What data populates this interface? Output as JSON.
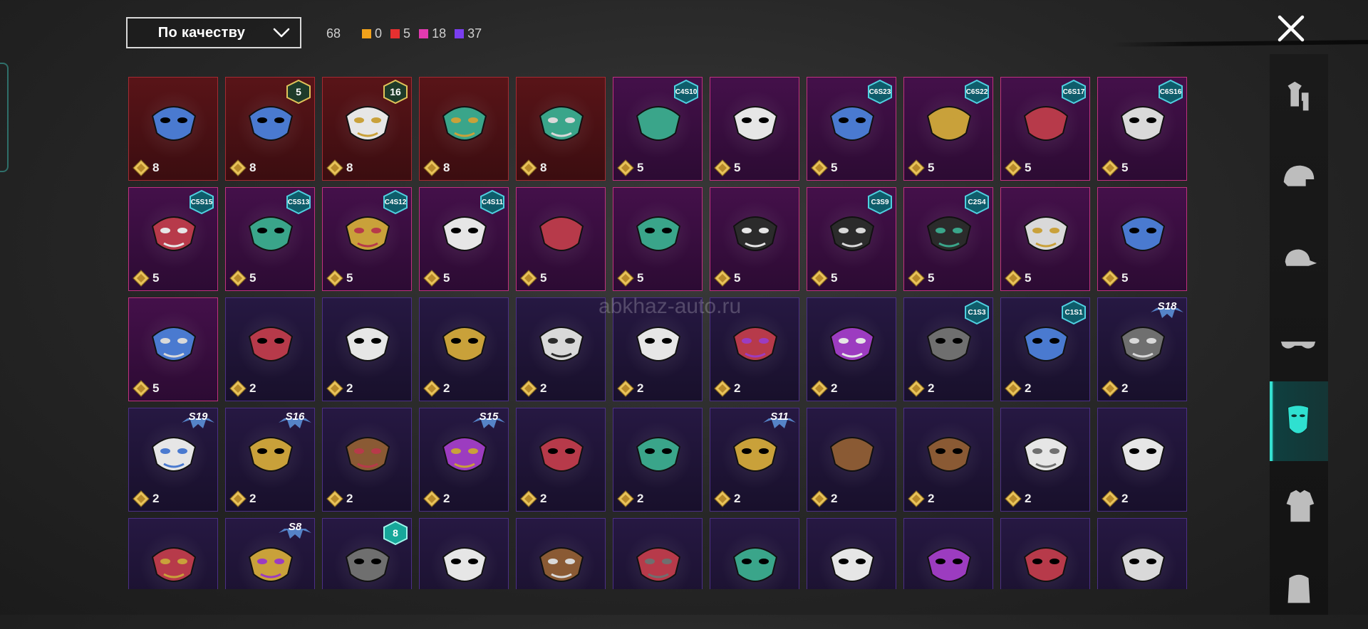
{
  "sort": {
    "label": "По качеству"
  },
  "counts": {
    "total": "68",
    "groups": [
      {
        "color": "#f2a21b",
        "value": "0"
      },
      {
        "color": "#e63030",
        "value": "5"
      },
      {
        "color": "#e23ab0",
        "value": "18"
      },
      {
        "color": "#7a3ef0",
        "value": "37"
      }
    ]
  },
  "watermark": "abkhaz-auto.ru",
  "items": [
    {
      "r": "red",
      "p": "8",
      "icon": "bug-gas-mask"
    },
    {
      "r": "red",
      "p": "8",
      "icon": "cyber-respirator",
      "b": {
        "t": "n",
        "v": "5"
      }
    },
    {
      "r": "red",
      "p": "8",
      "icon": "pharaoh-mask",
      "b": {
        "t": "n",
        "v": "16"
      }
    },
    {
      "r": "red",
      "p": "8",
      "icon": "cloth-face-mask"
    },
    {
      "r": "red",
      "p": "8",
      "icon": "dark-gas-mask"
    },
    {
      "r": "pink",
      "p": "5",
      "icon": "green-mouth-guard",
      "b": {
        "t": "h",
        "v": "C4S10"
      }
    },
    {
      "r": "pink",
      "p": "5",
      "icon": "brown-bandana"
    },
    {
      "r": "pink",
      "p": "5",
      "icon": "neon-face-mask",
      "b": {
        "t": "h",
        "v": "C6S23"
      }
    },
    {
      "r": "pink",
      "p": "5",
      "icon": "black-face-mask",
      "b": {
        "t": "h",
        "v": "C6S22"
      }
    },
    {
      "r": "pink",
      "p": "5",
      "icon": "cyan-visor-mask",
      "b": {
        "t": "h",
        "v": "C6S17"
      }
    },
    {
      "r": "pink",
      "p": "5",
      "icon": "bronze-gas-mask",
      "b": {
        "t": "h",
        "v": "C6S16"
      }
    },
    {
      "r": "pink",
      "p": "5",
      "icon": "yellow-respirator",
      "b": {
        "t": "h",
        "v": "C5S15"
      }
    },
    {
      "r": "pink",
      "p": "5",
      "icon": "graffiti-mask",
      "b": {
        "t": "h",
        "v": "C5S13"
      }
    },
    {
      "r": "pink",
      "p": "5",
      "icon": "fangs-face-mask",
      "b": {
        "t": "h",
        "v": "C4S12"
      }
    },
    {
      "r": "pink",
      "p": "5",
      "icon": "purple-respirator",
      "b": {
        "t": "h",
        "v": "C4S11"
      }
    },
    {
      "r": "pink",
      "p": "5",
      "icon": "kitsune-mask"
    },
    {
      "r": "pink",
      "p": "5",
      "icon": "pink-visor-mask"
    },
    {
      "r": "pink",
      "p": "5",
      "icon": "gold-warrior-mask"
    },
    {
      "r": "pink",
      "p": "5",
      "icon": "cyber-gas-mask",
      "b": {
        "t": "h",
        "v": "C3S9"
      }
    },
    {
      "r": "pink",
      "p": "5",
      "icon": "gold-robot-mask",
      "b": {
        "t": "h",
        "v": "C2S4"
      }
    },
    {
      "r": "pink",
      "p": "5",
      "icon": "white-cloth-mask"
    },
    {
      "r": "pink",
      "p": "5",
      "icon": "plague-doctor-mask"
    },
    {
      "r": "pink",
      "p": "5",
      "icon": "shredded-bandana"
    },
    {
      "r": "purple",
      "p": "2",
      "icon": "gold-venetian-mask"
    },
    {
      "r": "purple",
      "p": "2",
      "icon": "hockey-mask"
    },
    {
      "r": "purple",
      "p": "2",
      "icon": "armored-muzzle"
    },
    {
      "r": "purple",
      "p": "2",
      "icon": "red-eye-visor"
    },
    {
      "r": "purple",
      "p": "2",
      "icon": "mammoth-mask"
    },
    {
      "r": "purple",
      "p": "2",
      "icon": "pink-dino-mask"
    },
    {
      "r": "purple",
      "p": "2",
      "icon": "skull-teeth-mask"
    },
    {
      "r": "purple",
      "p": "2",
      "icon": "cactus-bandana",
      "b": {
        "t": "h",
        "v": "C1S3"
      }
    },
    {
      "r": "purple",
      "p": "2",
      "icon": "blue-shark-mask",
      "b": {
        "t": "h",
        "v": "C1S1"
      }
    },
    {
      "r": "purple",
      "p": "2",
      "icon": "heartbeat-mask",
      "b": {
        "t": "s",
        "v": "S18"
      }
    },
    {
      "r": "purple",
      "p": "2",
      "icon": "silver-visor-mask",
      "b": {
        "t": "s",
        "v": "S19"
      }
    },
    {
      "r": "purple",
      "p": "2",
      "icon": "gold-ninja-mask",
      "b": {
        "t": "s",
        "v": "S16"
      }
    },
    {
      "r": "purple",
      "p": "2",
      "icon": "dark-bandana"
    },
    {
      "r": "purple",
      "p": "2",
      "icon": "gold-skull-mask",
      "b": {
        "t": "s",
        "v": "S15"
      }
    },
    {
      "r": "purple",
      "p": "2",
      "icon": "tactical-goggles"
    },
    {
      "r": "purple",
      "p": "2",
      "icon": "purple-respirator-mask"
    },
    {
      "r": "purple",
      "p": "2",
      "icon": "red-face-mask",
      "b": {
        "t": "s",
        "v": "S11"
      }
    },
    {
      "r": "purple",
      "p": "2",
      "icon": "fox-mask"
    },
    {
      "r": "purple",
      "p": "2",
      "icon": "mummy-bandage"
    },
    {
      "r": "purple",
      "p": "2",
      "icon": "clown-mask"
    },
    {
      "r": "purple",
      "p": "2",
      "icon": "red-stripe-mask"
    },
    {
      "r": "purple",
      "p": "",
      "icon": "hair-wig"
    },
    {
      "r": "purple",
      "p": "",
      "icon": "flame-hood",
      "b": {
        "t": "s",
        "v": "S8"
      }
    },
    {
      "r": "purple",
      "p": "",
      "icon": "camo-mask",
      "b": {
        "t": "n",
        "v": "8",
        "c": "teal"
      }
    },
    {
      "r": "purple",
      "p": "",
      "icon": "black-gimp-mask"
    },
    {
      "r": "purple",
      "p": "",
      "icon": "dark-cloth-mask"
    },
    {
      "r": "purple",
      "p": "",
      "icon": "white-fur-mask"
    },
    {
      "r": "purple",
      "p": "",
      "icon": "graphic-face-mask"
    },
    {
      "r": "purple",
      "p": "",
      "icon": "patriot-mask"
    },
    {
      "r": "purple",
      "p": "",
      "icon": "vampire-mask"
    },
    {
      "r": "purple",
      "p": "",
      "icon": "gray-face-mask"
    },
    {
      "r": "purple",
      "p": "",
      "icon": "dark-skull-mask"
    }
  ],
  "sidebar": [
    {
      "name": "outfit-icon",
      "active": false
    },
    {
      "name": "helmet-icon",
      "active": false
    },
    {
      "name": "cap-icon",
      "active": false
    },
    {
      "name": "glasses-icon",
      "active": false
    },
    {
      "name": "face-mask-icon",
      "active": true
    },
    {
      "name": "jacket-icon",
      "active": false
    },
    {
      "name": "backpack-icon",
      "active": false
    }
  ]
}
